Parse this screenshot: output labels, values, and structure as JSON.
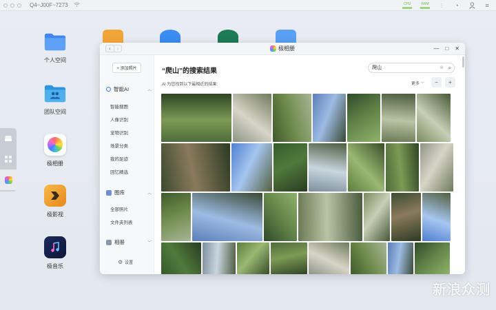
{
  "topbar": {
    "device_name": "Q4~J00F~7273",
    "stats": [
      {
        "label": "CPU"
      },
      {
        "label": "RAM"
      }
    ]
  },
  "desktop": {
    "icons": [
      {
        "label": "个人空间",
        "icon": "folder-icon",
        "color": "#4a8ef0"
      },
      {
        "label": "团队空间",
        "icon": "team-folder-icon",
        "color": "#3aa6e8"
      },
      {
        "label": "极相册",
        "icon": "photos-icon",
        "color": "#ffffff"
      },
      {
        "label": "极影视",
        "icon": "video-icon",
        "color": "#f0a12e"
      },
      {
        "label": "极音乐",
        "icon": "music-icon",
        "color": "#2b56e0"
      }
    ]
  },
  "window": {
    "title": "极相册",
    "nav": {
      "back": "‹",
      "forward": "›"
    },
    "controls": {
      "minimize": "—",
      "maximize": "□",
      "close": "✕"
    }
  },
  "sidebar": {
    "add_button": "+ 添加照片",
    "sections": [
      {
        "title": "智能AI",
        "items": [
          "智能搜图",
          "人像识别",
          "宠物识别",
          "场景分类",
          "我的足迹",
          "回忆精选"
        ]
      },
      {
        "title": "图库",
        "items": [
          "全部照片",
          "文件夹列表"
        ]
      },
      {
        "title": "相册",
        "items": []
      }
    ],
    "settings": "设置"
  },
  "main": {
    "query_title": "“爬山”的搜索结果",
    "search_value": "爬山",
    "hint": "AI 为您找到以下最相近的结果:",
    "more_label": "更多",
    "zoom_out": "−",
    "zoom_in": "+"
  }
}
